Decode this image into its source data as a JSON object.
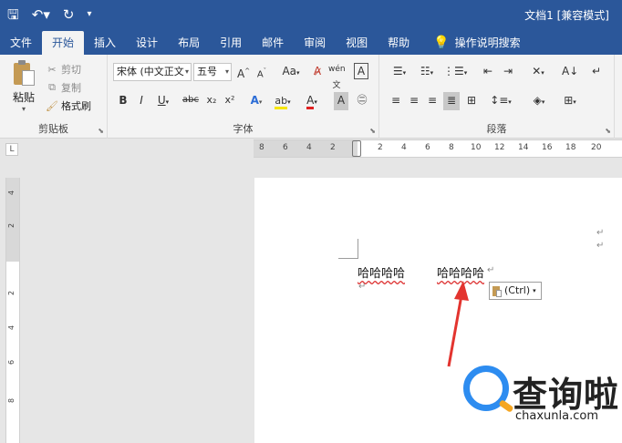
{
  "title_bar": {
    "doc_title": "文档1 [兼容模式]",
    "qat": {
      "save_icon": "save-icon",
      "undo_icon": "undo-icon",
      "redo_icon": "redo-icon",
      "customize_icon": "customize-icon"
    }
  },
  "tabs": [
    "文件",
    "开始",
    "插入",
    "设计",
    "布局",
    "引用",
    "邮件",
    "审阅",
    "视图",
    "帮助"
  ],
  "active_tab": "开始",
  "tell_me": "操作说明搜索",
  "ribbon": {
    "clipboard": {
      "paste": "粘贴",
      "cut": "剪切",
      "copy": "复制",
      "format_painter": "格式刷",
      "label": "剪贴板"
    },
    "font": {
      "font_name": "宋体 (中文正文",
      "font_size": "五号",
      "grow": "A",
      "shrink": "A",
      "aa": "Aa",
      "bold": "B",
      "italic": "I",
      "underline": "U",
      "strike": "abc",
      "subscript": "x₂",
      "superscript": "x²",
      "label": "字体"
    },
    "paragraph": {
      "label": "段落"
    }
  },
  "ruler": {
    "h_ticks": [
      "8",
      "6",
      "4",
      "2",
      "2",
      "4",
      "6",
      "8",
      "10",
      "12",
      "14",
      "16",
      "18",
      "20"
    ],
    "v_ticks": [
      "4",
      "2",
      "2",
      "4",
      "6",
      "8"
    ]
  },
  "document": {
    "text1": "哈哈哈哈",
    "text2": "哈哈哈哈",
    "paragraph_mark": "↵"
  },
  "paste_options": {
    "label": "(Ctrl)"
  },
  "watermark": {
    "cn": "查询啦",
    "en": "chaxunla.com"
  },
  "colors": {
    "title_bar": "#2b579a",
    "ribbon": "#f3f3f3",
    "arrow": "#e3342f",
    "accent_blue": "#2d8cf0"
  }
}
